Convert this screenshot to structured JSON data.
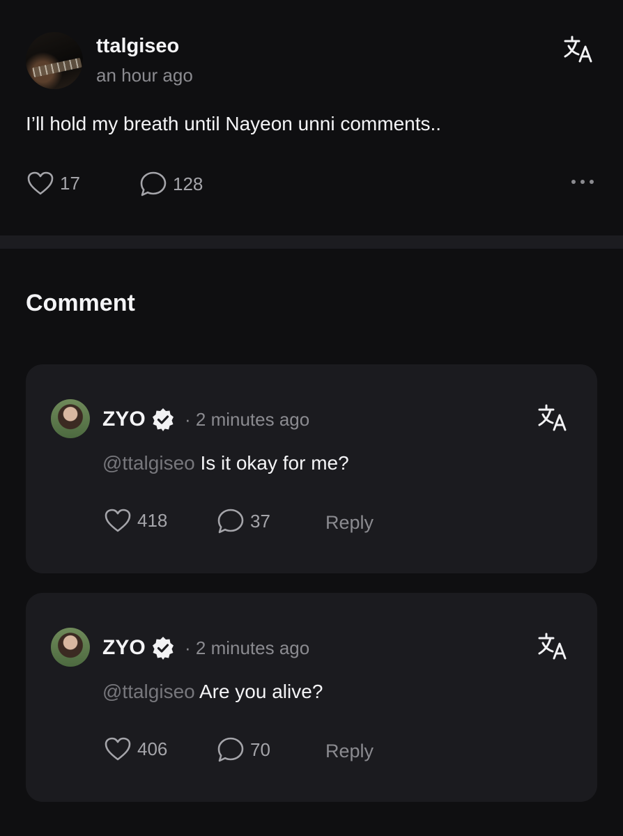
{
  "post": {
    "author": "ttalgiseo",
    "time": "an hour ago",
    "body": "I’ll hold my breath until Nayeon unni comments..",
    "likes": "17",
    "comments": "128"
  },
  "section": {
    "title": "Comment"
  },
  "comments": [
    {
      "author": "ZYO",
      "time": "· 2 minutes ago",
      "mention": "@ttalgiseo",
      "text": "Is it okay for me?",
      "likes": "418",
      "replies": "37",
      "reply_label": "Reply"
    },
    {
      "author": "ZYO",
      "time": "· 2 minutes ago",
      "mention": "@ttalgiseo",
      "text": "Are you alive?",
      "likes": "406",
      "replies": "70",
      "reply_label": "Reply"
    }
  ],
  "icons": {
    "translate": "translate-icon",
    "like": "heart-icon",
    "comment": "speech-bubble-icon",
    "more": "more-dots-icon",
    "verified": "verified-badge-icon"
  },
  "colors": {
    "background": "#0f0f11",
    "card": "#1b1b1f",
    "muted": "#8b8b90"
  }
}
